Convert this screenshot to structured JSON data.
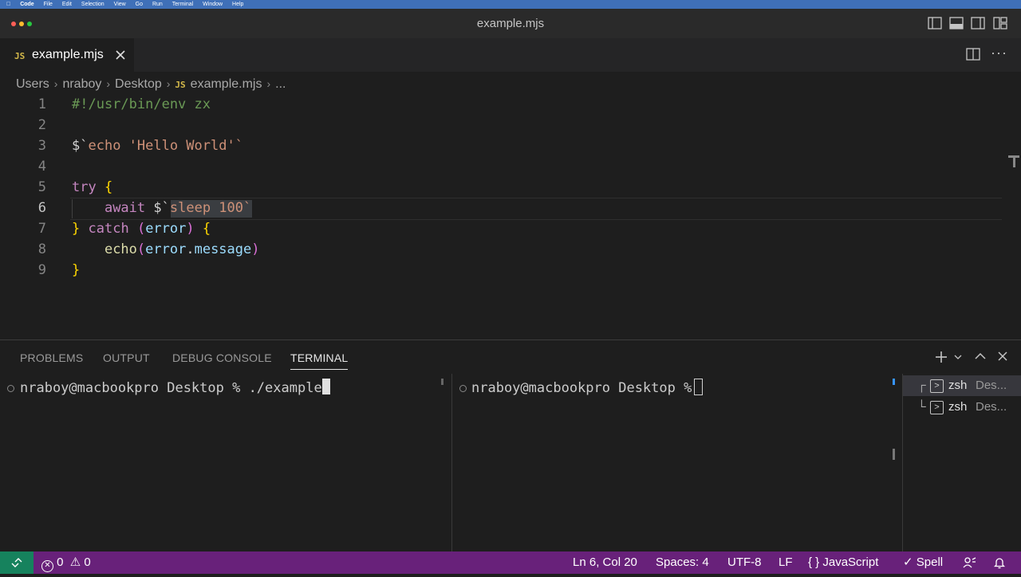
{
  "menubar": {
    "app": "Code",
    "items": [
      "File",
      "Edit",
      "Selection",
      "View",
      "Go",
      "Run",
      "Terminal",
      "Window",
      "Help"
    ]
  },
  "window": {
    "title": "example.mjs"
  },
  "tab": {
    "icon": "JS",
    "label": "example.mjs"
  },
  "breadcrumb": {
    "parts": [
      "Users",
      "nraboy",
      "Desktop"
    ],
    "file_icon": "JS",
    "file": "example.mjs",
    "tail": "..."
  },
  "editor": {
    "line_numbers": [
      "1",
      "2",
      "3",
      "4",
      "5",
      "6",
      "7",
      "8",
      "9"
    ],
    "active_line": 6,
    "lines": {
      "l1": "#!/usr/bin/env zx",
      "l3_a": "$`",
      "l3_b": "echo 'Hello World'",
      "l3_c": "`",
      "l5_kw": "try",
      "l5_brace": "{",
      "l6_kw": "await",
      "l6_a": "$`",
      "l6_b": "sleep 100",
      "l6_c": "`",
      "l7_brace": "}",
      "l7_kw": "catch",
      "l7_p1": "(",
      "l7_var": "error",
      "l7_p2": ")",
      "l7_brace2": "{",
      "l8_fn": "echo",
      "l8_p1": "(",
      "l8_var": "error",
      "l8_dot": ".",
      "l8_prop": "message",
      "l8_p2": ")",
      "l9_brace": "}"
    }
  },
  "panel": {
    "tabs": [
      "PROBLEMS",
      "OUTPUT",
      "DEBUG CONSOLE",
      "TERMINAL"
    ],
    "active_tab": "TERMINAL",
    "terminal_left": "nraboy@macbookpro Desktop % ./example.",
    "terminal_right": "nraboy@macbookpro Desktop % ",
    "terminals": [
      {
        "name": "zsh",
        "detail": "Des..."
      },
      {
        "name": "zsh",
        "detail": "Des..."
      }
    ]
  },
  "status": {
    "errors": "0",
    "warnings": "0",
    "position": "Ln 6, Col 20",
    "spaces": "Spaces: 4",
    "encoding": "UTF-8",
    "eol": "LF",
    "language": "JavaScript",
    "spell": "Spell"
  },
  "colors": {
    "statusbar": "#68217a",
    "remote": "#16825d",
    "editor_bg": "#1e1e1e"
  }
}
